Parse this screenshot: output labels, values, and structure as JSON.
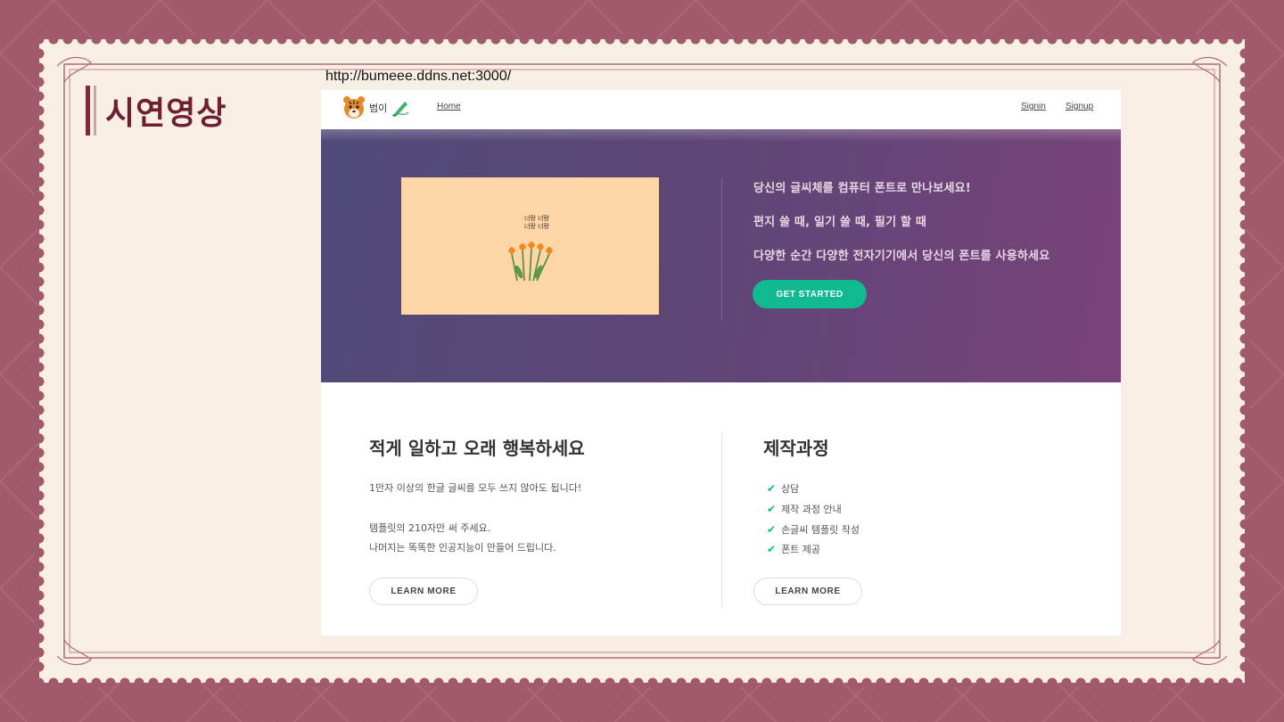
{
  "slide": {
    "title": "시연영상",
    "url": "http://bumeee.ddns.net:3000/"
  },
  "colors": {
    "background": "#a05a6c",
    "stamp_paper": "#f7efe4",
    "title": "#6e1f33",
    "accent_green": "#10b990",
    "hero_gradient_start": "#4f4a78",
    "hero_gradient_end": "#7a4379",
    "card": "#fdd5a6"
  },
  "nav": {
    "logo_text": "범이",
    "home": "Home",
    "signin": "Signin",
    "signup": "Signup"
  },
  "hero": {
    "card_text_1": "너랑 너랑",
    "card_text_2": "너랑 너랑",
    "line1": "당신의 글씨체를 컴퓨터 폰트로 만나보세요!",
    "line2": "편지 쓸 때, 일기 쓸 때, 필기 할 때",
    "line3": "다양한 순간 다양한 전자기기에서 당신의 폰트를 사용하세요",
    "cta": "GET STARTED"
  },
  "left": {
    "title": "적게 일하고 오래 행복하세요",
    "p1": "1만자 이상의 한글 글씨를 모두 쓰지 않아도 됩니다!",
    "p2": "템플릿의 210자만 써 주세요.",
    "p3": "나머지는 똑똑한 인공지능이 만들어 드립니다.",
    "button": "LEARN MORE"
  },
  "right": {
    "title": "제작과정",
    "steps": [
      "상담",
      "제작 과정 안내",
      "손글씨 템플릿 작성",
      "폰트 제공"
    ],
    "button": "LEARN MORE"
  },
  "icons": {
    "logo": "tiger-face-icon",
    "brand": "pen-icon",
    "check": "check-icon",
    "flowers": "tulip-icon"
  }
}
